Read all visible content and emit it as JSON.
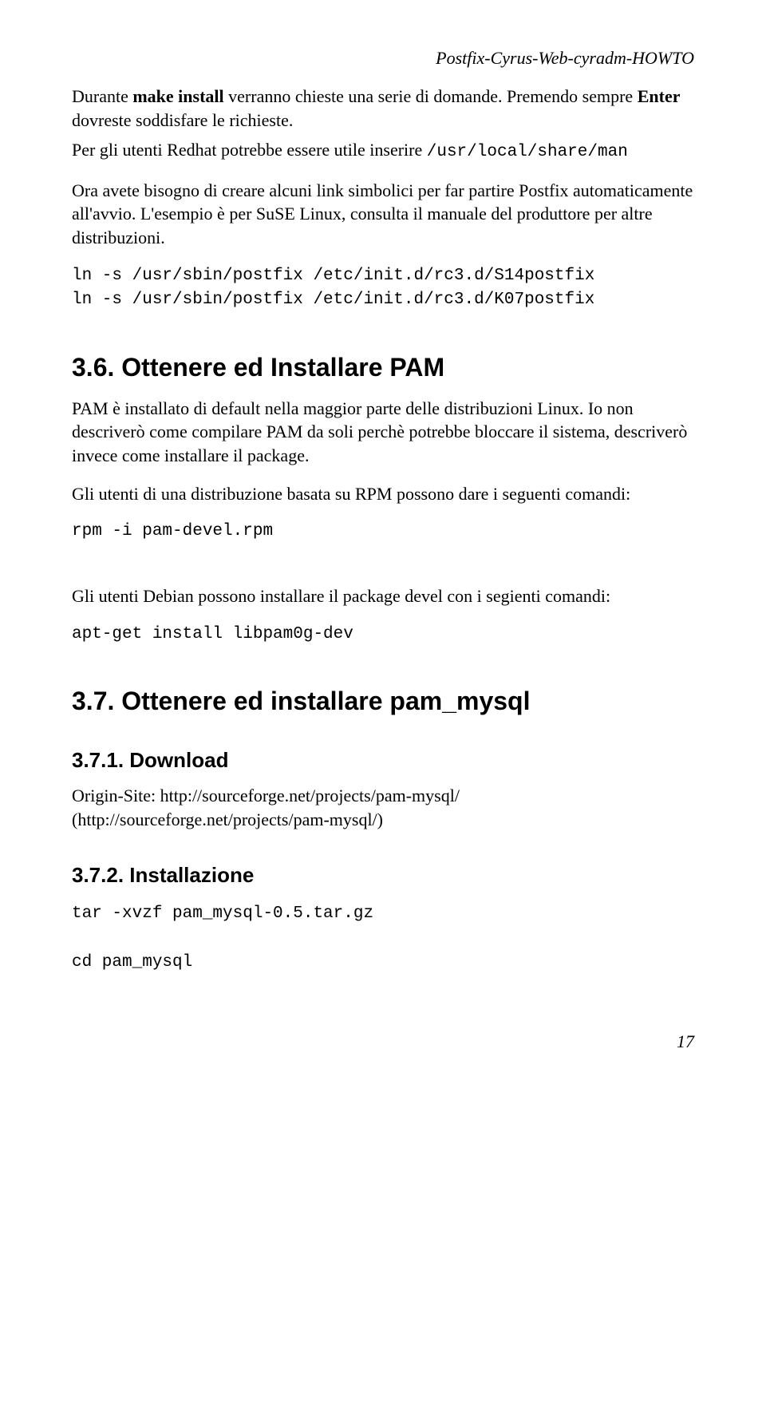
{
  "header": {
    "running_title": "Postfix-Cyrus-Web-cyradm-HOWTO"
  },
  "intro": {
    "line1_a": "Durante ",
    "line1_b": "make install",
    "line1_c": " verranno chieste una serie di domande. Premendo sempre ",
    "line2_a": "Enter",
    "line2_b": " dovreste soddisfare le richieste.",
    "line3_a": "Per gli utenti Redhat potrebbe essere utile inserire ",
    "line3_b": "/usr/local/share/man",
    "line4": "Ora avete bisogno di creare alcuni link simbolici per far partire Postfix automaticamente all'avvio. L'esempio è per SuSE Linux, consulta il manuale del produttore per altre distribuzioni.",
    "code1": "ln -s /usr/sbin/postfix /etc/init.d/rc3.d/S14postfix\nln -s /usr/sbin/postfix /etc/init.d/rc3.d/K07postfix"
  },
  "s36": {
    "title": "3.6. Ottenere ed Installare PAM",
    "p1": "PAM è installato di default nella maggior parte delle distribuzioni Linux. Io non descriverò come compilare PAM da soli perchè potrebbe bloccare il sistema, descriverò invece come installare il package.",
    "p2": "Gli utenti di una distribuzione basata su RPM possono dare i seguenti comandi:",
    "code1": "rpm -i pam-devel.rpm",
    "p3": "Gli utenti Debian possono installare il package devel con i segienti comandi:",
    "code2": "apt-get install libpam0g-dev"
  },
  "s37": {
    "title": "3.7. Ottenere ed installare pam_mysql",
    "s371_title": "3.7.1. Download",
    "s371_p": "Origin-Site: http://sourceforge.net/projects/pam-mysql/ (http://sourceforge.net/projects/pam-mysql/)",
    "s372_title": "3.7.2. Installazione",
    "s372_code": "tar -xvzf pam_mysql-0.5.tar.gz\n\ncd pam_mysql"
  },
  "pagenum": "17"
}
